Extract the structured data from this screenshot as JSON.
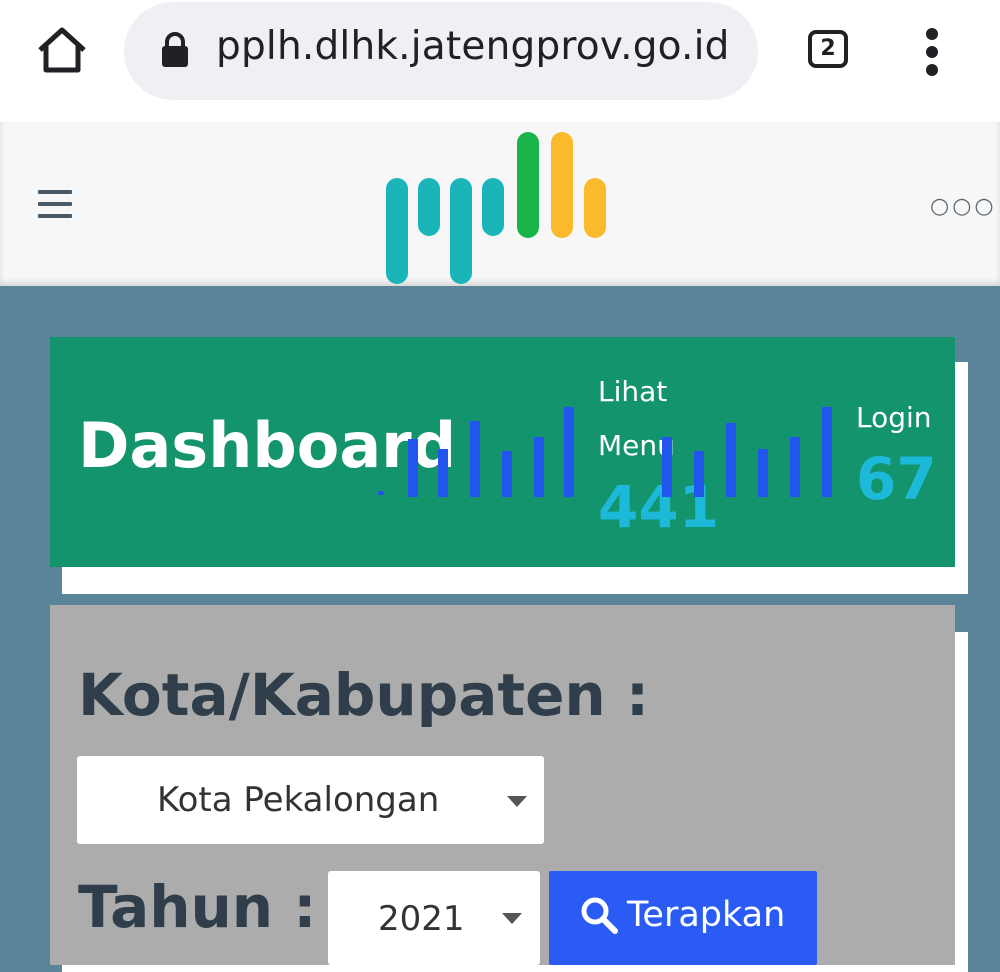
{
  "browser": {
    "url": "pplh.dlhk.jatengprov.go.id",
    "tab_count": "2",
    "icons": [
      "home-icon",
      "lock-icon",
      "tab-switcher-icon",
      "kebab-menu-icon"
    ]
  },
  "site_header": {
    "logo_text": "pplh",
    "logo_colors": {
      "teal": "#19b5b8",
      "green": "#19b34a",
      "yellow": "#fbb92c"
    },
    "icons": [
      "hamburger-icon",
      "more-dots-icon"
    ]
  },
  "dashboard": {
    "title": "Dashboard",
    "background": "#13946c",
    "stats": [
      {
        "label_line1": "Lihat",
        "label_line2": "Menu",
        "value": "441"
      },
      {
        "label_line1": "Login",
        "label_line2": "",
        "value": "67"
      }
    ],
    "value_color": "#1db9d8",
    "spark_color": "#2255ee"
  },
  "filter": {
    "city_label": "Kota/Kabupaten :",
    "city_selected": "Kota Pekalongan",
    "year_label": "Tahun :",
    "year_selected": "2021",
    "apply_button": "Terapkan",
    "apply_color": "#2a5cf5"
  }
}
